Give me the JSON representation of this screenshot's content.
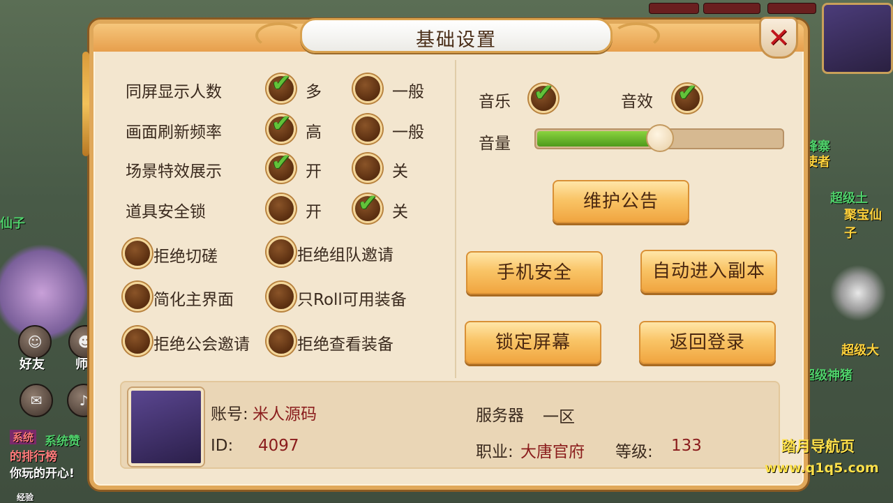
{
  "dialog": {
    "title": "基础设置",
    "close_icon": "close-icon"
  },
  "display_options": [
    {
      "label": "同屏显示人数",
      "option_a": "多",
      "option_a_checked": true,
      "option_b": "一般",
      "option_b_checked": false
    },
    {
      "label": "画面刷新频率",
      "option_a": "高",
      "option_a_checked": true,
      "option_b": "一般",
      "option_b_checked": false
    },
    {
      "label": "场景特效展示",
      "option_a": "开",
      "option_a_checked": true,
      "option_b": "关",
      "option_b_checked": false
    },
    {
      "label": "道具安全锁",
      "option_a": "开",
      "option_a_checked": false,
      "option_b": "关",
      "option_b_checked": true
    }
  ],
  "toggles": [
    {
      "label": "拒绝切磋",
      "checked": false
    },
    {
      "label": "拒绝组队邀请",
      "checked": false
    },
    {
      "label": "简化主界面",
      "checked": false
    },
    {
      "label": "只Roll可用装备",
      "checked": false
    },
    {
      "label": "拒绝公会邀请",
      "checked": false
    },
    {
      "label": "拒绝查看装备",
      "checked": false
    }
  ],
  "audio": {
    "music_label": "音乐",
    "music_checked": true,
    "sfx_label": "音效",
    "sfx_checked": true,
    "volume_label": "音量",
    "volume_fraction": 0.49
  },
  "buttons": {
    "notice": "维护公告",
    "phone_security": "手机安全",
    "auto_dungeon": "自动进入副本",
    "lock_screen": "锁定屏幕",
    "back_login": "返回登录"
  },
  "account": {
    "account_label": "账号:",
    "account_value": "米人源码",
    "id_label": "ID:",
    "id_value": "4097",
    "server_label": "服务器",
    "server_value": "一区",
    "job_label": "职业:",
    "job_value": "大唐官府",
    "level_label": "等级:",
    "level_value": "133"
  },
  "background": {
    "texts": [
      "仙子",
      "超级土",
      "聚宝仙子",
      "峰寨",
      "使者",
      "好友",
      "师徒",
      "系统",
      "系统赞",
      "的排行榜",
      "你玩的开心!",
      "超级大",
      "超级神猪",
      "经验"
    ]
  },
  "watermark": {
    "title": "踏月导航页",
    "url": "www.q1q5.com"
  },
  "colors": {
    "check_green": "#62c23a",
    "button_gold": "#f9c466",
    "close_red": "#c2161c",
    "value_red": "#8a1c1c"
  }
}
